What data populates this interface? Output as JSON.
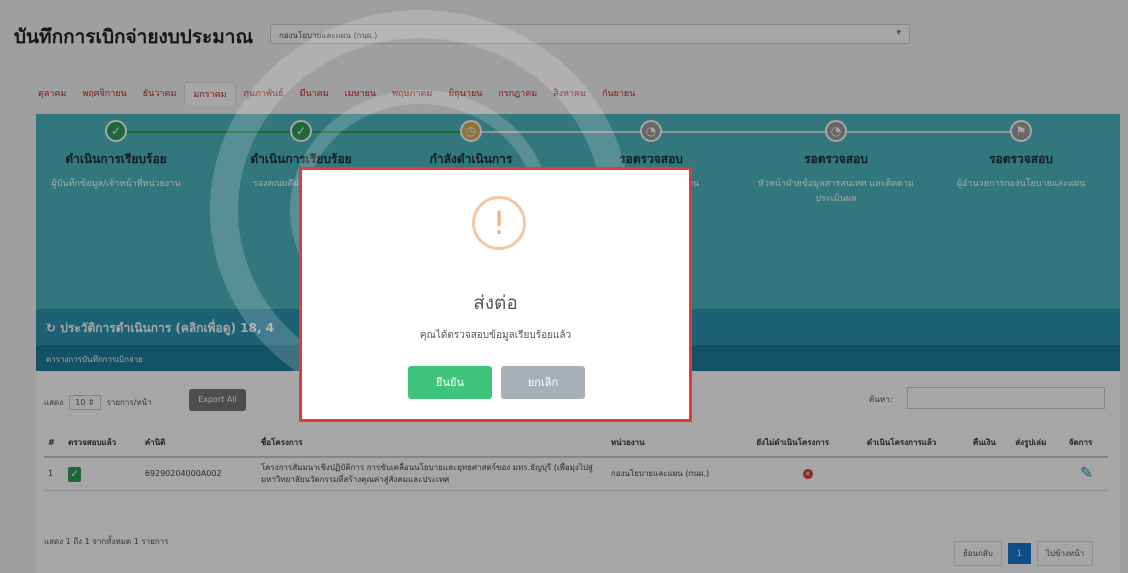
{
  "header": {
    "title": "บันทึกการเบิกจ่ายงบประมาณ",
    "fund_select_value": "กองนโยบายและแผน (กนผ.)"
  },
  "months": [
    "ตุลาคม",
    "พฤศจิกายน",
    "ธันวาคม",
    "มกราคม",
    "กุมภาพันธ์",
    "มีนาคม",
    "เมษายน",
    "พฤษภาคม",
    "มิถุนายน",
    "กรกฎาคม",
    "สิงหาคม",
    "กันยายน"
  ],
  "months_active": "มกราคม",
  "steps": [
    {
      "title": "ดำเนินการเรียบร้อย",
      "subtitle": "ผู้บันทึกข้อมูล/เจ้าหน้าที่หน่วยงาน",
      "status": "done"
    },
    {
      "title": "ดำเนินการเรียบร้อย",
      "subtitle": "รองคณบดีฝ่ายวางแผน/ผู้",
      "status": "done"
    },
    {
      "title": "กำลังดำเนินการ",
      "subtitle": "",
      "status": "current"
    },
    {
      "title": "รอตรวจสอบ",
      "subtitle": "ละติดตาม ยบายและแผน",
      "status": "pending"
    },
    {
      "title": "รอตรวจสอบ",
      "subtitle": "หัวหน้าฝ่ายข้อมูลสารสนเทศ และติดตามประเมินผล",
      "status": "pending"
    },
    {
      "title": "รอตรวจสอบ",
      "subtitle": "ผู้อำนวยการกองนโยบายและแผน",
      "status": "pending"
    }
  ],
  "history": {
    "label": "ประวัติการดำเนินการ (คลิกเพื่อดู) 18, 4",
    "strip_label": "ตารางการบันทึกการเบิกจ่าย"
  },
  "table_controls": {
    "show_label": "แสดง",
    "page_size": "10",
    "per_page_label": "รายการ/หน้า",
    "export_label": "Export All",
    "search_label": "ค้นหา:"
  },
  "table": {
    "headers": [
      "#",
      "ตรวจสอบแล้ว",
      "คำนิติ",
      "ชื่อโครงการ",
      "หน่วยงาน",
      "ยังไม่ดำเนินโครงการ",
      "ดำเนินโครงการแล้ว",
      "คืนเงิน",
      "ส่งรูปเล่ม",
      "จัดการ"
    ],
    "rows": [
      {
        "num": "1",
        "code": "69290204000A002",
        "name": "โครงการสัมมนาเชิงปฏิบัติการ การขับเคลื่อนนโยบายและยุทธศาสตร์ของ มทร.ธัญบุรี (เพื่อมุ่งไปสู่มหาวิทยาลัยนวัตกรรมที่สร้างคุณค่าสู่สังคมและประเทศ",
        "unit": "กองนโยบายและแผน (กนผ.)"
      }
    ],
    "info": "แสดง 1 ถึง 1 จากทั้งหมด 1 รายการ"
  },
  "pagination": {
    "prev": "ย้อนกลับ",
    "page": "1",
    "next": "ไปข้างหน้า"
  },
  "modal": {
    "title": "ส่งต่อ",
    "text": "คุณได้ตรวจสอบข้อมูลเรียบร้อยแล้ว",
    "confirm_label": "ยืนยัน",
    "cancel_label": "ยกเลิก",
    "icon": "warning-icon"
  },
  "colors": {
    "accent": "#4fb7c2",
    "confirm": "#3ec47b",
    "highlight": "#e53935"
  }
}
